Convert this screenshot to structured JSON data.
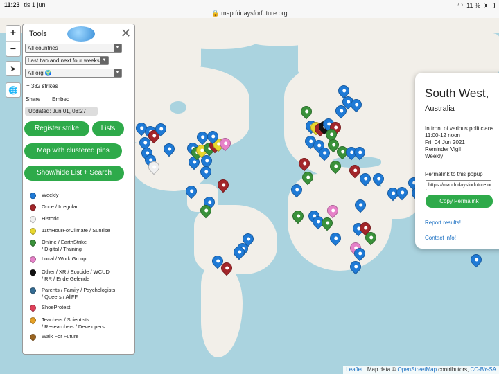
{
  "status_bar": {
    "time": "11:23",
    "date": "tis 1 juni",
    "battery": "11 %"
  },
  "browser": {
    "url": "map.fridaysforfuture.org"
  },
  "map_controls": {
    "zoom_in": "+",
    "zoom_out": "−"
  },
  "tools": {
    "title": "Tools",
    "country_select": "All countries",
    "period_select": "Last two and next four weeks",
    "org_select": "All org",
    "strikes_count": "= 382 strikes",
    "share_label": "Share",
    "embed_label": "Embed",
    "updated": "Updated: Jun 01, 08:27",
    "register_strike": "Register strike",
    "lists": "Lists",
    "clustered_pins": "Map with clustered pins",
    "show_hide": "Show/hide List + Search",
    "legend": [
      {
        "label": "Weekly",
        "color": "#1f7ad6"
      },
      {
        "label": "Once / Irregular",
        "color": "#a3262a"
      },
      {
        "label": "Historic",
        "color": "#f0f0f0"
      },
      {
        "label": "11thHourForClimate / Sunrise",
        "color": "#e8d72e"
      },
      {
        "label": "Online / EarthStrike\n/ Digital / Training",
        "color": "#3a913a"
      },
      {
        "label": "Local / Work Group",
        "color": "#e681c8"
      },
      {
        "label": "Other / XR / Ecocide / WCUD\n/ RR / Ende Gelende",
        "color": "#111111"
      },
      {
        "label": "Parents / Family / Psychologists\n/ Queers / AllFF",
        "color": "#356c93"
      },
      {
        "label": "ShoeProtest",
        "color": "#e0405a"
      },
      {
        "label": "Teachers / Scientists\n/ Researchers / Developers",
        "color": "#e5a026"
      },
      {
        "label": "Walk For Future",
        "color": "#9a6420"
      }
    ]
  },
  "popup": {
    "title": "South West,",
    "subtitle": "Australia",
    "line1": "In front of various politicians",
    "line2": "11:00-12 noon",
    "line3": "Fri, 04 Jun 2021",
    "line4": "Reminder Vigil",
    "line5": "Weekly",
    "permalink_label": "Permalink to this popup",
    "permalink_url": "https://map.fridaysforfuture.org",
    "copy_button": "Copy Permalink",
    "report": "Report results!",
    "contact": "Contact info!"
  },
  "attribution": {
    "leaflet": "Leaflet",
    "map_data": " | Map data © ",
    "osm": "OpenStreetMap",
    "contrib": " contributors, ",
    "license": "CC-BY-SA"
  }
}
